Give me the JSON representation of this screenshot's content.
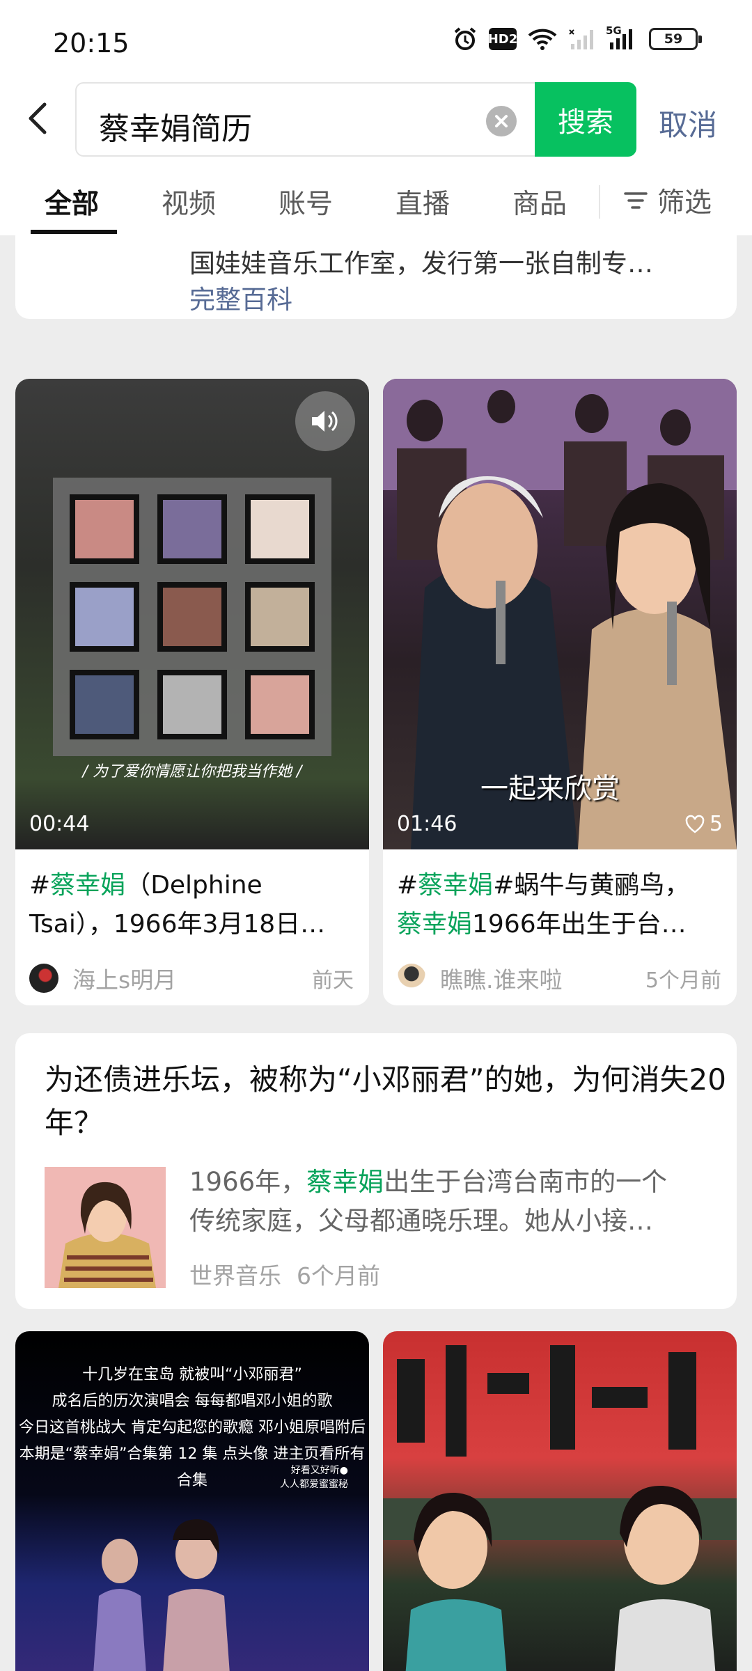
{
  "status_bar": {
    "time": "20:15",
    "hd_label": "HD2",
    "network_label": "5G",
    "battery": "59"
  },
  "search": {
    "query": "蔡幸娟简历",
    "button_label": "搜索",
    "cancel_label": "取消"
  },
  "tabs": [
    {
      "label": "全部",
      "active": true
    },
    {
      "label": "视频"
    },
    {
      "label": "账号"
    },
    {
      "label": "直播"
    },
    {
      "label": "商品"
    }
  ],
  "filter_label": "筛选",
  "baike_card": {
    "text": "国娃娃音乐工作室，发行第一张自制专…",
    "link": "完整百科"
  },
  "videos": [
    {
      "duration": "00:44",
      "subtitle": "/ 为了爱你情愿让你把我当作她 /",
      "title_hashtag": "#",
      "title_highlight": "蔡幸娟",
      "title_line1_rest": "（Delphine",
      "title_line2": "Tsai），1966年3月18日…",
      "author": "海上s明月",
      "time": "前天"
    },
    {
      "duration": "01:46",
      "likes": "5",
      "overlay_text": "一起来欣赏",
      "title_hashtag": "#",
      "title_highlight": "蔡幸娟",
      "title_line1_rest": "#蜗牛与黄鹂鸟，",
      "title_line2_highlight": "蔡幸娟",
      "title_line2": "1966年出生于台…",
      "author": "瞧瞧.谁来啦",
      "time": "5个月前"
    }
  ],
  "article": {
    "title": "为还债进乐坛，被称为“小邓丽君”的她，为何消失20年？",
    "desc_prefix": "1966年，",
    "desc_highlight": "蔡幸娟",
    "desc_line1_rest": "出生于台湾台南市的一个",
    "desc_line2": "传统家庭，父母都通晓乐理。她从小接…",
    "source": "世界音乐",
    "time": "6个月前"
  },
  "bottom_video_captions": [
    "十几岁在宝岛 就被叫“小邓丽君”",
    "成名后的历次演唱会 每每都唱邓小姐的歌",
    "今日这首桃战大 肯定勾起您的歌瘾 邓小姐原唱附后",
    "本期是“蔡幸娟”合集第 12 集 点头像 进主页看所有合集"
  ],
  "bottom_video_side": [
    "好看又好听●",
    "人人都爱蜜蜜秘"
  ]
}
